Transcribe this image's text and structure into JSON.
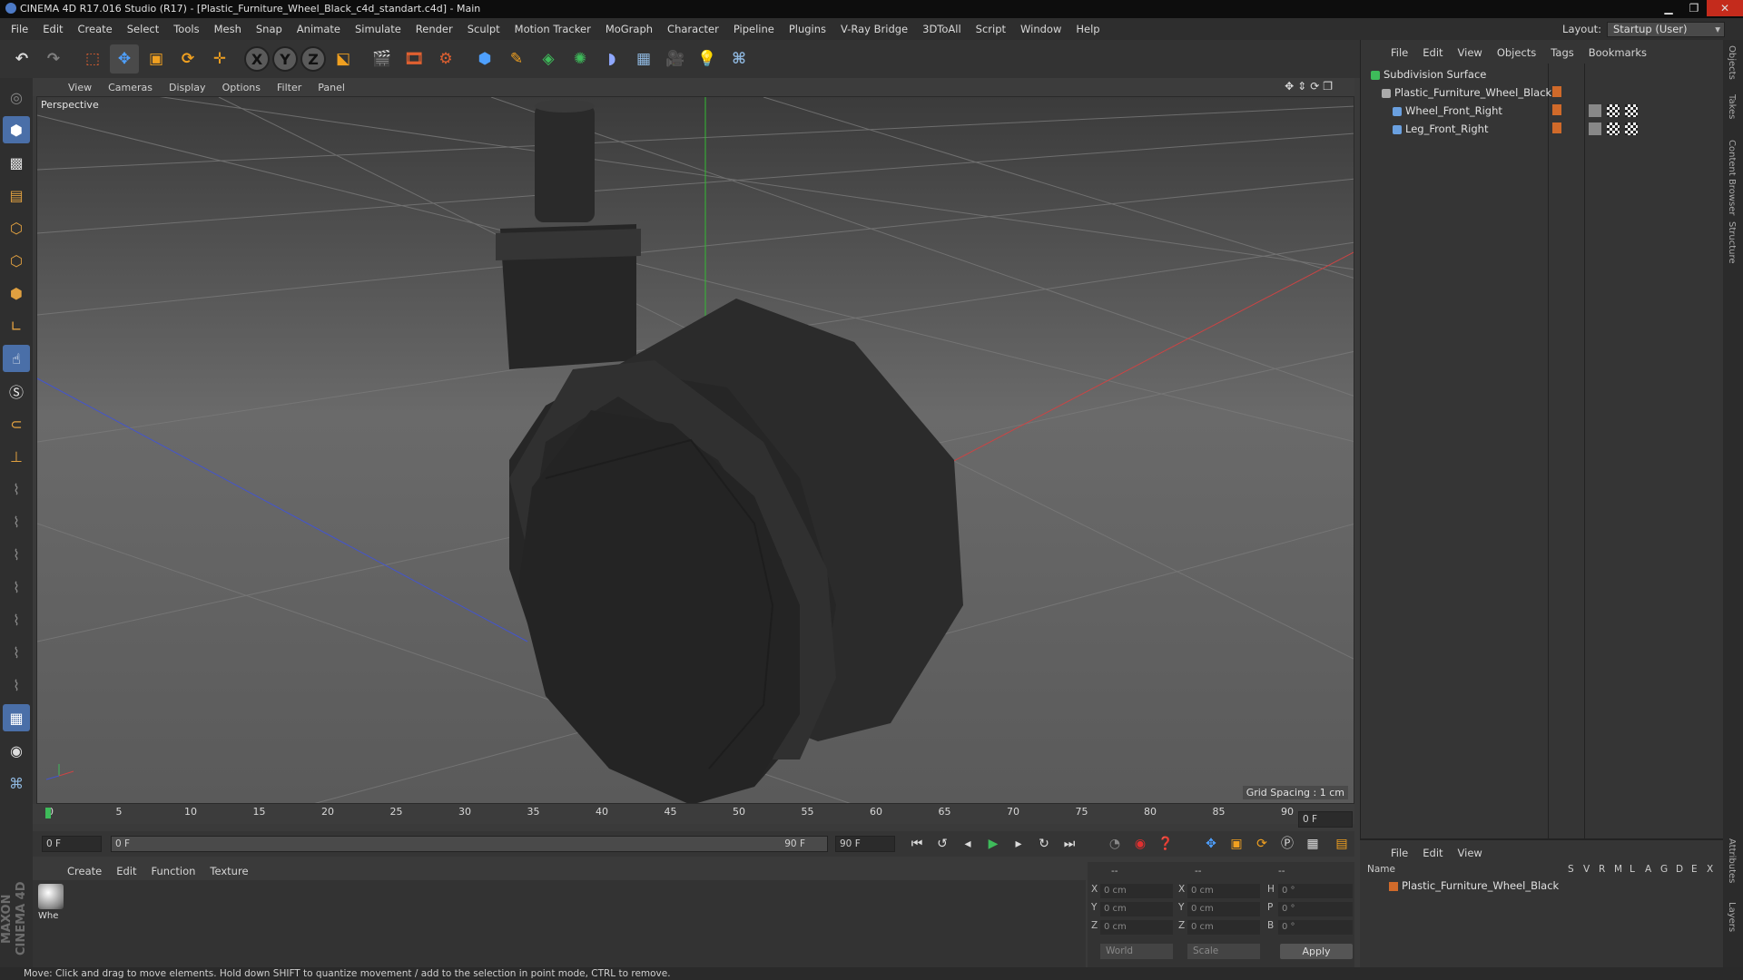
{
  "window": {
    "title": "CINEMA 4D R17.016 Studio (R17) - [Plastic_Furniture_Wheel_Black_c4d_standart.c4d] - Main"
  },
  "menubar": [
    "File",
    "Edit",
    "Create",
    "Select",
    "Tools",
    "Mesh",
    "Snap",
    "Animate",
    "Simulate",
    "Render",
    "Sculpt",
    "Motion Tracker",
    "MoGraph",
    "Character",
    "Pipeline",
    "Plugins",
    "V-Ray Bridge",
    "3DToAll",
    "Script",
    "Window",
    "Help"
  ],
  "layout": {
    "label": "Layout:",
    "value": "Startup (User)"
  },
  "toolbar": {
    "axis_x": "X",
    "axis_y": "Y",
    "axis_z": "Z"
  },
  "viewport": {
    "menu": [
      "View",
      "Cameras",
      "Display",
      "Options",
      "Filter",
      "Panel"
    ],
    "camera_label": "Perspective",
    "grid_spacing": "Grid Spacing : 1 cm"
  },
  "timeline": {
    "ticks": [
      "0",
      "5",
      "10",
      "15",
      "20",
      "25",
      "30",
      "35",
      "40",
      "45",
      "50",
      "55",
      "60",
      "65",
      "70",
      "75",
      "80",
      "85",
      "90"
    ],
    "end_frame_display": "0 F",
    "current_frame": "0 F",
    "range_start": "0 F",
    "range_end": "90 F",
    "max_frame": "90 F"
  },
  "material_manager": {
    "menu": [
      "Create",
      "Edit",
      "Function",
      "Texture"
    ],
    "materials": [
      {
        "name": "Whe"
      }
    ]
  },
  "coordinates": {
    "header": [
      "--",
      "--",
      "--"
    ],
    "rows": [
      {
        "axis": "X",
        "pos": "0 cm",
        "axis2": "X",
        "size": "0 cm",
        "rot_axis": "H",
        "rot": "0 °"
      },
      {
        "axis": "Y",
        "pos": "0 cm",
        "axis2": "Y",
        "size": "0 cm",
        "rot_axis": "P",
        "rot": "0 °"
      },
      {
        "axis": "Z",
        "pos": "0 cm",
        "axis2": "Z",
        "size": "0 cm",
        "rot_axis": "B",
        "rot": "0 °"
      }
    ],
    "space": "World",
    "mode": "Scale",
    "apply": "Apply"
  },
  "object_manager": {
    "menu": [
      "File",
      "Edit",
      "View",
      "Objects",
      "Tags",
      "Bookmarks"
    ],
    "objects": [
      {
        "name": "Subdivision Surface",
        "level": 0
      },
      {
        "name": "Plastic_Furniture_Wheel_Black",
        "level": 1
      },
      {
        "name": "Wheel_Front_Right",
        "level": 2
      },
      {
        "name": "Leg_Front_Right",
        "level": 2
      }
    ]
  },
  "layer_manager": {
    "menu": [
      "File",
      "Edit",
      "View"
    ],
    "columns": [
      "Name",
      "S",
      "V",
      "R",
      "M",
      "L",
      "A",
      "G",
      "D",
      "E",
      "X"
    ],
    "layers": [
      {
        "name": "Plastic_Furniture_Wheel_Black",
        "color": "#d06a2a"
      }
    ]
  },
  "right_tabs": [
    "Objects",
    "Takes",
    "Content Browser",
    "Structure",
    "Attributes",
    "Layers"
  ],
  "branding": "MAXON CINEMA 4D",
  "status": "Move: Click and drag to move elements. Hold down SHIFT to quantize movement / add to the selection in point mode, CTRL to remove.",
  "colors": {
    "accent_orange": "#d06a2a",
    "playhead_green": "#3ebb5a",
    "selected_tool_blue": "#4a6fa8"
  }
}
